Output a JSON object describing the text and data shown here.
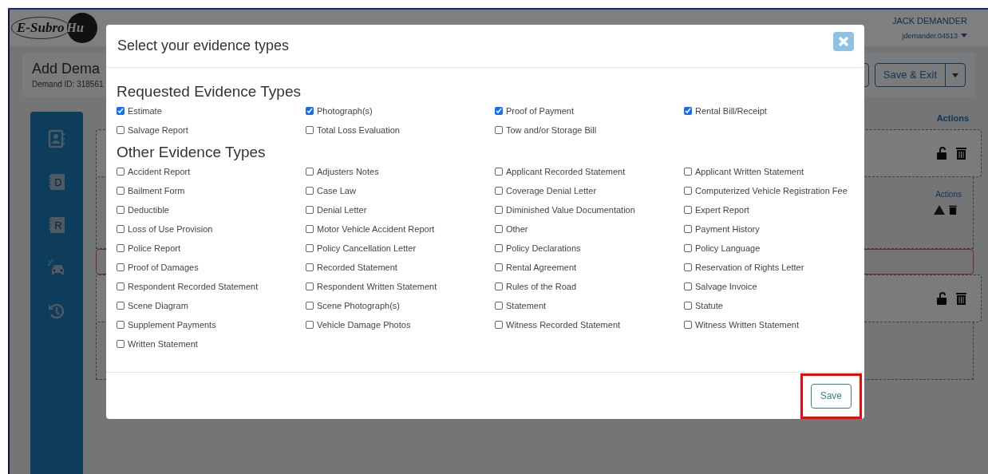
{
  "app": {
    "logo_text": "E-Subro",
    "logo_badge": "Hu",
    "user_name": "JACK DEMANDER",
    "username": "jdemander.04513",
    "page_title": "Add Dema",
    "demand_id": "Demand ID: 318561",
    "save_exit": "Save & Exit",
    "actions_labels": [
      "Actions",
      "Actions"
    ],
    "sidebar": [
      {
        "kind": "contact"
      },
      {
        "kind": "notebook",
        "glyph": "D"
      },
      {
        "kind": "notebook",
        "glyph": "R"
      },
      {
        "kind": "car"
      },
      {
        "kind": "history"
      }
    ]
  },
  "modal": {
    "title": "Select your evidence types",
    "sections": [
      {
        "heading": "Requested Evidence Types",
        "items": [
          {
            "label": "Estimate",
            "checked": true
          },
          {
            "label": "Photograph(s)",
            "checked": true
          },
          {
            "label": "Proof of Payment",
            "checked": true
          },
          {
            "label": "Rental Bill/Receipt",
            "checked": true
          },
          {
            "label": "Salvage Report",
            "checked": false
          },
          {
            "label": "Total Loss Evaluation",
            "checked": false
          },
          {
            "label": "Tow and/or Storage Bill",
            "checked": false
          }
        ]
      },
      {
        "heading": "Other Evidence Types",
        "items": [
          {
            "label": "Accident Report",
            "checked": false
          },
          {
            "label": "Adjusters Notes",
            "checked": false
          },
          {
            "label": "Applicant Recorded Statement",
            "checked": false
          },
          {
            "label": "Applicant Written Statement",
            "checked": false
          },
          {
            "label": "Bailment Form",
            "checked": false
          },
          {
            "label": "Case Law",
            "checked": false
          },
          {
            "label": "Coverage Denial Letter",
            "checked": false
          },
          {
            "label": "Computerized Vehicle Registration Fee",
            "checked": false
          },
          {
            "label": "Deductible",
            "checked": false
          },
          {
            "label": "Denial Letter",
            "checked": false
          },
          {
            "label": "Diminished Value Documentation",
            "checked": false
          },
          {
            "label": "Expert Report",
            "checked": false
          },
          {
            "label": "Loss of Use Provision",
            "checked": false
          },
          {
            "label": "Motor Vehicle Accident Report",
            "checked": false
          },
          {
            "label": "Other",
            "checked": false
          },
          {
            "label": "Payment History",
            "checked": false
          },
          {
            "label": "Police Report",
            "checked": false
          },
          {
            "label": "Policy Cancellation Letter",
            "checked": false
          },
          {
            "label": "Policy Declarations",
            "checked": false
          },
          {
            "label": "Policy Language",
            "checked": false
          },
          {
            "label": "Proof of Damages",
            "checked": false
          },
          {
            "label": "Recorded Statement",
            "checked": false
          },
          {
            "label": "Rental Agreement",
            "checked": false
          },
          {
            "label": "Reservation of Rights Letter",
            "checked": false
          },
          {
            "label": "Respondent Recorded Statement",
            "checked": false
          },
          {
            "label": "Respondent Written Statement",
            "checked": false
          },
          {
            "label": "Rules of the Road",
            "checked": false
          },
          {
            "label": "Salvage Invoice",
            "checked": false
          },
          {
            "label": "Scene Diagram",
            "checked": false
          },
          {
            "label": "Scene Photograph(s)",
            "checked": false
          },
          {
            "label": "Statement",
            "checked": false
          },
          {
            "label": "Statute",
            "checked": false
          },
          {
            "label": "Supplement Payments",
            "checked": false
          },
          {
            "label": "Vehicle Damage Photos",
            "checked": false
          },
          {
            "label": "Witness Recorded Statement",
            "checked": false
          },
          {
            "label": "Witness Written Statement",
            "checked": false
          },
          {
            "label": "Written Statement",
            "checked": false
          }
        ]
      }
    ],
    "save_button": {
      "label": "Save",
      "highlighted": true
    }
  }
}
